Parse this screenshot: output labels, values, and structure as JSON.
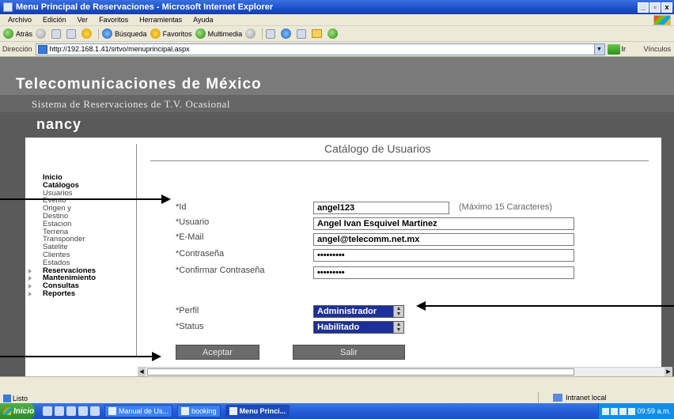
{
  "window": {
    "title": "Menu Principal de Reservaciones - Microsoft Internet Explorer",
    "min_label": "_",
    "max_label": "▫",
    "close_label": "x"
  },
  "menu": [
    "Archivo",
    "Edición",
    "Ver",
    "Favoritos",
    "Herramientas",
    "Ayuda"
  ],
  "toolbar": {
    "back": "Atrás",
    "search": "Búsqueda",
    "favorites": "Favoritos",
    "multimedia": "Multimedia"
  },
  "address": {
    "label": "Dirección",
    "url": "http://192.168.1.41/srtvo/menuprincipal.aspx",
    "go": "Ir",
    "links": "Vínculos"
  },
  "header": {
    "brand": "Telecomunicaciones de México",
    "subtitle": "Sistema de Reservaciones de T.V. Ocasional",
    "user": "nancy"
  },
  "sidebar": {
    "inicio": "Inicio",
    "catalogos": "Catálogos",
    "sub": [
      "Usuarios",
      "Evento",
      "Origen y",
      "Destino",
      "Estacion",
      "Terrena",
      "Transponder",
      "Satelite",
      "Clientes",
      "Estados"
    ],
    "sections": [
      "Reservaciones",
      "Mantenimiento",
      "Consultas",
      "Reportes"
    ]
  },
  "form": {
    "title": "Catálogo de Usuarios",
    "labels": {
      "id": "*Id",
      "usuario": "*Usuario",
      "email": "*E-Mail",
      "password": "*Contraseña",
      "confirm": "*Confirmar Contraseña",
      "perfil": "*Perfil",
      "status": "*Status"
    },
    "values": {
      "id": "angel123",
      "usuario": "Angel Ivan Esquivel Martinez",
      "email": "angel@telecomm.net.mx",
      "password": "•••••••••",
      "confirm": "•••••••••",
      "perfil": "Administrador",
      "status": "Habilitado"
    },
    "id_hint": "(Máximo 15 Caracteres)",
    "accept_button": "Aceptar",
    "exit_button": "Salir"
  },
  "status": {
    "text": "Listo",
    "zone": "Intranet local"
  },
  "taskbar": {
    "start": "Inicio",
    "tasks": [
      "Manual de Us...",
      "booking",
      "Menu Princi..."
    ],
    "clock": "09:59 a.m."
  }
}
